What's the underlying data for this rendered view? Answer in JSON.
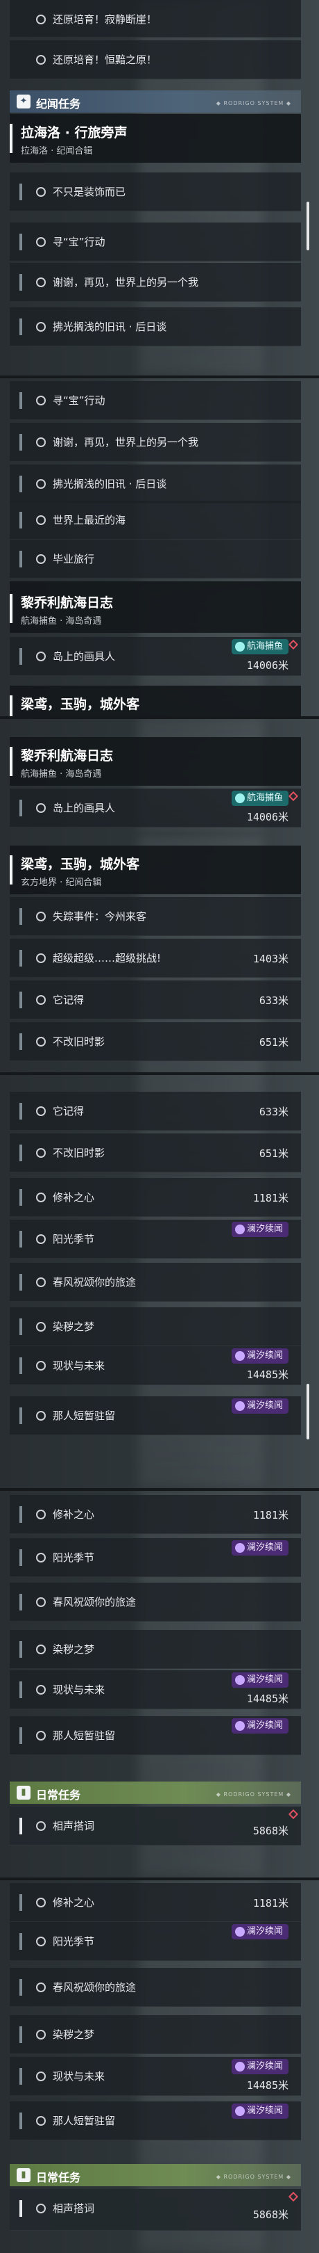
{
  "texts": {
    "huanyuan1": "还原培育！寂静断崖！",
    "huanyuan2": "还原培育！恒黯之原！",
    "jiwen_cat": "纪闻任务",
    "lahai_title": "拉海洛 · 行旅旁声",
    "lahai_sub": "拉海洛 · 纪闻合辑",
    "bushi": "不只是装饰而已",
    "xunbao": "寻“宝”行动",
    "xiexie": "谢谢，再见，世界上的另一个我",
    "fuguang": "拂光搁浅的旧讯 · 后日谈",
    "zuijin": "世界上最近的海",
    "biye": "毕业旅行",
    "lqz_title": "黎乔利航海日志",
    "lqz_sub": "航海捕鱼 · 海岛奇遇",
    "daoshang": "岛上的画具人",
    "hanghai_tag": "航海捕鱼",
    "liang_title": "梁鸢，玉驹，城外客",
    "liang_sub": "玄方地界 · 纪闻合辑",
    "shizong": "失踪事件：今州来客",
    "chaoji": "超级超级……超级挑战!",
    "taji": "它记得",
    "bugai": "不改旧时影",
    "xiubu": "修补之心",
    "yangguang": "阳光季节",
    "chunfeng": "春风祝颂你的旅途",
    "ranyang": "染秽之梦",
    "xianzhuang": "现状与未来",
    "naren": "那人短暂驻留",
    "lanxi_tag": "澜汐续闻",
    "richang_cat": "日常任务",
    "xiangjian": "相声搭词",
    "d14006": "14006米",
    "d1403": "1403米",
    "d633": "633米",
    "d651": "651米",
    "d1181": "1181米",
    "d14485": "14485米",
    "d5868": "5868米",
    "deco": "◆ RODRIGO SYSTEM ◆"
  },
  "colors": {
    "jiwen_cat": "#3b4f66",
    "richang_cat": "#5d7a42",
    "lanxi_tag": "#4b2b73",
    "hanghai_tag": "#1c6a6a"
  }
}
